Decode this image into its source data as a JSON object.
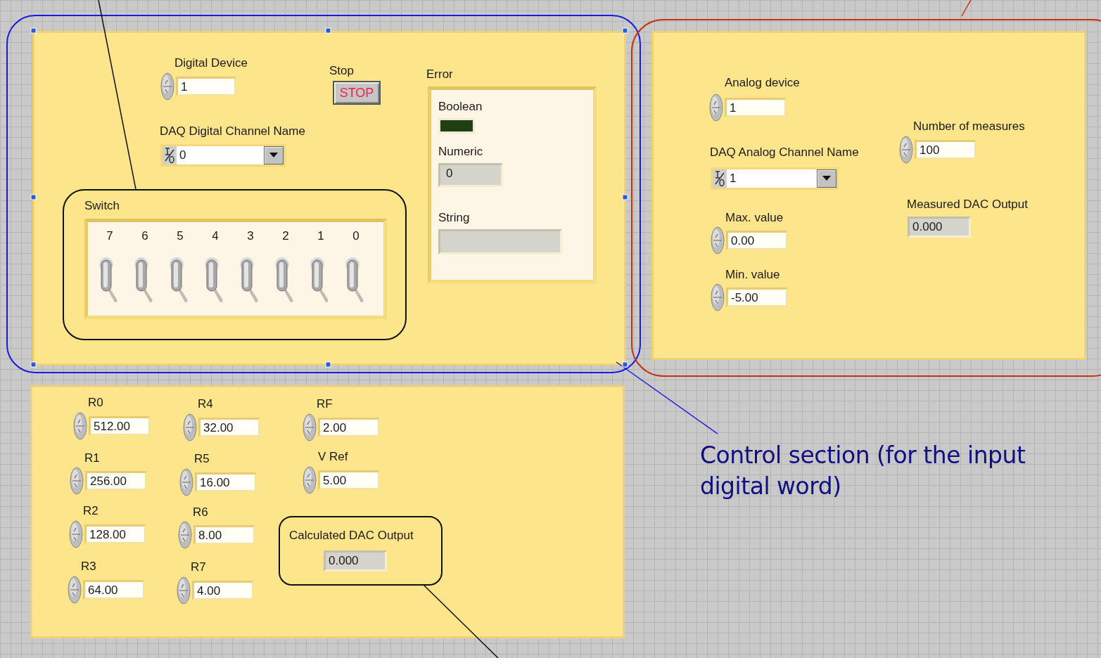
{
  "digital_section": {
    "controls": [
      {
        "kind": "numeric",
        "label": "Digital Device",
        "value": "1"
      },
      {
        "kind": "button",
        "label": "Stop",
        "text": "STOP"
      },
      {
        "kind": "channel",
        "label": "DAQ Digital Channel Name",
        "value": "0"
      }
    ]
  },
  "switch_array": {
    "label": "Switch",
    "switches": [
      {
        "label": "7",
        "on": false
      },
      {
        "label": "6",
        "on": false
      },
      {
        "label": "5",
        "on": false
      },
      {
        "label": "4",
        "on": false
      },
      {
        "label": "3",
        "on": false
      },
      {
        "label": "2",
        "on": false
      },
      {
        "label": "1",
        "on": false
      },
      {
        "label": "0",
        "on": false
      }
    ]
  },
  "error_cluster": {
    "label": "Error",
    "boolean": {
      "label": "Boolean",
      "on": false
    },
    "numeric": {
      "label": "Numeric",
      "value": "0"
    },
    "string": {
      "label": "String"
    }
  },
  "analog_section": {
    "controls": [
      {
        "kind": "numeric",
        "label": "Analog device",
        "value": "1"
      },
      {
        "kind": "channel",
        "label": "DAQ Analog Channel Name",
        "value": "1"
      },
      {
        "kind": "numeric",
        "label": "Max. value",
        "value": "0.00"
      },
      {
        "kind": "numeric",
        "label": "Min. value",
        "value": "-5.00"
      },
      {
        "kind": "numeric",
        "label": "Number of measures",
        "value": "100"
      },
      {
        "kind": "indicator",
        "label": "Measured DAC Output",
        "value": "0.000"
      }
    ]
  },
  "resistor_section": {
    "controls": [
      {
        "kind": "numeric",
        "label": "R0",
        "value": "512.00"
      },
      {
        "kind": "numeric",
        "label": "R1",
        "value": "256.00"
      },
      {
        "kind": "numeric",
        "label": "R2",
        "value": "128.00"
      },
      {
        "kind": "numeric",
        "label": "R3",
        "value": "64.00"
      },
      {
        "kind": "numeric",
        "label": "R4",
        "value": "32.00"
      },
      {
        "kind": "numeric",
        "label": "R5",
        "value": "16.00"
      },
      {
        "kind": "numeric",
        "label": "R6",
        "value": "8.00"
      },
      {
        "kind": "numeric",
        "label": "R7",
        "value": "4.00"
      },
      {
        "kind": "numeric",
        "label": "RF",
        "value": "2.00"
      },
      {
        "kind": "numeric",
        "label": "V Ref",
        "value": "5.00"
      },
      {
        "kind": "indicator",
        "label": "Calculated DAC Output",
        "value": "0.000"
      }
    ]
  },
  "annotation": {
    "text": "Control section (for the input digital word)"
  }
}
